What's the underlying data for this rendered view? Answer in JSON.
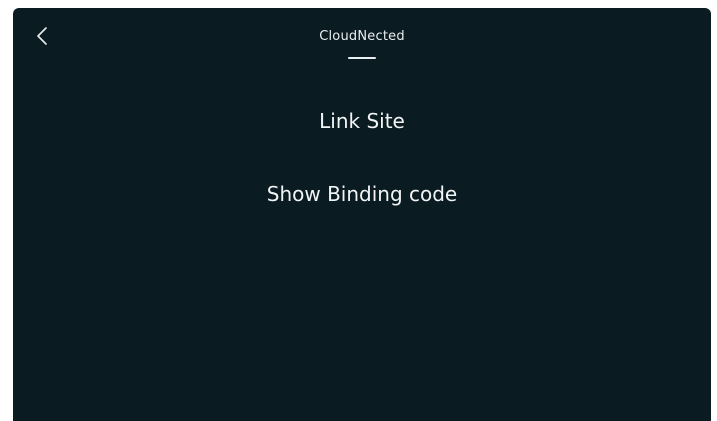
{
  "header": {
    "title": "CloudNected",
    "back_icon": "chevron-left-icon"
  },
  "menu": {
    "items": [
      {
        "label": "Link Site"
      },
      {
        "label": "Show Binding code"
      }
    ]
  },
  "colors": {
    "background": "#0b1b22",
    "text": "#e9eef0"
  }
}
